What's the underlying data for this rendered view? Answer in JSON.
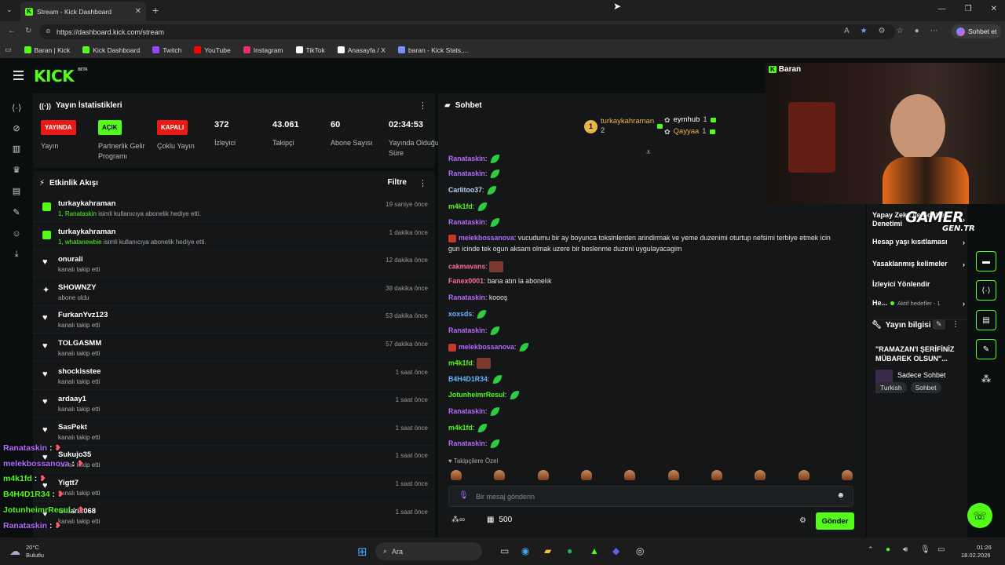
{
  "browser": {
    "tab_title": "Stream - Kick Dashboard",
    "url": "https://dashboard.kick.com/stream",
    "copilot_label": "Sohbet et",
    "bookmarks": [
      {
        "label": "Baran | Kick",
        "color": "#53fc18"
      },
      {
        "label": "Kick Dashboard",
        "color": "#53fc18"
      },
      {
        "label": "Twitch",
        "color": "#9146ff"
      },
      {
        "label": "YouTube",
        "color": "#ff0000"
      },
      {
        "label": "Instagram",
        "color": "#e1306c"
      },
      {
        "label": "TikTok",
        "color": "#ffffff"
      },
      {
        "label": "Anasayfa / X",
        "color": "#ffffff"
      },
      {
        "label": "baran - Kick Stats,...",
        "color": "#7f8cff"
      }
    ]
  },
  "app": {
    "logo": "KICK",
    "logo_sup": "BETA",
    "accent": "#53fc18"
  },
  "stats": {
    "title": "Yayın İstatistikleri",
    "items": [
      {
        "badge": "YAYINDA",
        "label": "Yayın",
        "badge_color": "#e91916"
      },
      {
        "badge": "AÇIK",
        "label": "Partnerlik Gelir Programı",
        "badge_color": "#53fc18"
      },
      {
        "badge": "KAPALI",
        "label": "Çoklu Yayın",
        "badge_color": "#e91916"
      },
      {
        "value": "372",
        "label": "İzleyici"
      },
      {
        "value": "43.061",
        "label": "Takipçi"
      },
      {
        "value": "60",
        "label": "Abone Sayısı"
      },
      {
        "value": "02:34:53",
        "label": "Yayında Olduğu Süre"
      }
    ]
  },
  "activity": {
    "title": "Etkinlik Akışı",
    "filter_label": "Filtre",
    "rows": [
      {
        "name": "turkaykahraman",
        "desc_hl": "1, Ranataskin",
        "desc": " isimli kullanıcıya abonelik hediye etti.",
        "time": "19 saniye önce",
        "icon": "gift"
      },
      {
        "name": "turkaykahraman",
        "desc_hl": "1, whatanewbie",
        "desc": " isimli kullanıcıya abonelik hediye etti.",
        "time": "1 dakika önce",
        "icon": "gift"
      },
      {
        "name": "onurali",
        "desc_hl": "",
        "desc": "kanalı takip etti",
        "time": "12 dakika önce",
        "icon": "heart"
      },
      {
        "name": "SHOWNZY",
        "desc_hl": "",
        "desc": "abone oldu",
        "time": "38 dakika önce",
        "icon": "star"
      },
      {
        "name": "FurkanYvz123",
        "desc_hl": "",
        "desc": "kanalı takip etti",
        "time": "53 dakika önce",
        "icon": "heart"
      },
      {
        "name": "TOLGASMM",
        "desc_hl": "",
        "desc": "kanalı takip etti",
        "time": "57 dakika önce",
        "icon": "heart"
      },
      {
        "name": "shockisstee",
        "desc_hl": "",
        "desc": "kanalı takip etti",
        "time": "1 saat önce",
        "icon": "heart"
      },
      {
        "name": "ardaay1",
        "desc_hl": "",
        "desc": "kanalı takip etti",
        "time": "1 saat önce",
        "icon": "heart"
      },
      {
        "name": "SasPekt",
        "desc_hl": "",
        "desc": "kanalı takip etti",
        "time": "1 saat önce",
        "icon": "heart"
      },
      {
        "name": "Sukujo35",
        "desc_hl": "",
        "desc": "kanalı takip etti",
        "time": "1 saat önce",
        "icon": "heart"
      },
      {
        "name": "Yigtt7",
        "desc_hl": "",
        "desc": "kanalı takip etti",
        "time": "1 saat önce",
        "icon": "heart"
      },
      {
        "name": "Gillaris068",
        "desc_hl": "",
        "desc": "kanalı takip etti",
        "time": "1 saat önce",
        "icon": "heart"
      }
    ]
  },
  "chat": {
    "title": "Sohbet",
    "leaderboard": [
      {
        "rank": "1",
        "name": "turkaykahraman",
        "count": "2"
      },
      {
        "name": "eymhub",
        "count": "1"
      },
      {
        "name": "Qayyaa",
        "count": "1"
      }
    ],
    "messages": [
      {
        "user": "Ranataskin",
        "color": "#b36bff",
        "text": "",
        "emote": "leaf"
      },
      {
        "user": "Ranataskin",
        "color": "#b36bff",
        "text": "",
        "emote": "leaf"
      },
      {
        "user": "Carlitoo37",
        "color": "#b9d1ff",
        "text": "",
        "emote": "leaf"
      },
      {
        "user": "m4k1fd",
        "color": "#53fc18",
        "text": "",
        "emote": "leaf"
      },
      {
        "user": "Ranataskin",
        "color": "#b36bff",
        "text": "",
        "emote": "leaf"
      },
      {
        "user": "melekbossanova",
        "color": "#b36bff",
        "text": "vucudumu bir ay boyunca toksinlerden arindirmak ve yeme duzenimi oturtup nefsimi terbiye etmek icin",
        "cont": "gun icinde tek ogun aksam olmak uzere bir beslenme duzeni uygulayacagim",
        "emote": "",
        "sub": true
      },
      {
        "user": "cakmavans",
        "color": "#ff6b9a",
        "text": "",
        "emote": "img"
      },
      {
        "user": "Fanex0001",
        "color": "#ff6b9a",
        "text": "bana atın la abonelık",
        "emote": ""
      },
      {
        "user": "Ranataskin",
        "color": "#b36bff",
        "text": "koooş",
        "emote": ""
      },
      {
        "user": "xoxsds",
        "color": "#6bb5ff",
        "text": "",
        "emote": "leaf"
      },
      {
        "user": "Ranataskin",
        "color": "#b36bff",
        "text": "",
        "emote": "leaf"
      },
      {
        "user": "melekbossanova",
        "color": "#b36bff",
        "text": "",
        "emote": "leaf",
        "sub": true
      },
      {
        "user": "m4k1fd",
        "color": "#53fc18",
        "text": "",
        "emote": "img"
      },
      {
        "user": "B4H4D1R34",
        "color": "#6bb5ff",
        "text": "",
        "emote": "leaf"
      },
      {
        "user": "JotunheimrResul",
        "color": "#53fc18",
        "text": "",
        "emote": "leaf"
      },
      {
        "user": "Ranataskin",
        "color": "#b36bff",
        "text": "",
        "emote": "leaf"
      },
      {
        "user": "m4k1fd",
        "color": "#53fc18",
        "text": "",
        "emote": "leaf"
      },
      {
        "user": "Ranataskin",
        "color": "#b36bff",
        "text": "",
        "emote": "leaf"
      }
    ],
    "followers_only_label": "Takipçilere Özel",
    "input_placeholder": "Bir mesaj gönderin",
    "points_value": "500",
    "send_label": "Gönder"
  },
  "right": {
    "settings": [
      {
        "label": "Yapay Zeka ile Sohbet Denetimi"
      },
      {
        "label": "Hesap yaşı kısıtlaması"
      },
      {
        "label": "Yasaklanmış kelimeler"
      },
      {
        "label": "İzleyici Yönlendir"
      },
      {
        "label": "He...",
        "note": "Aktif hedefler - 1"
      }
    ],
    "stream_info_title": "Yayın bilgisi",
    "stream_title": "\"RAMAZAN'I ŞERİFİNİZ MÜBAREK OLSUN\"...",
    "category": "Sadece Sohbet",
    "tags": [
      "Turkish",
      "Sohbet"
    ]
  },
  "webcam": {
    "name": "Baran",
    "overlay_text": "GAMER",
    "overlay_sub": "GEN.TR"
  },
  "overlay_chat": [
    {
      "user": "Ranataskin",
      "color": "#b36bff"
    },
    {
      "user": "melekbossanova",
      "color": "#b36bff"
    },
    {
      "user": "m4k1fd",
      "color": "#53fc18"
    },
    {
      "user": "B4H4D1R34",
      "color": "#53fc18"
    },
    {
      "user": "JotunheimrResul",
      "color": "#53fc18"
    },
    {
      "user": "Ranataskin",
      "color": "#b36bff"
    },
    {
      "user": "m4k1fd",
      "color": "#53fc18"
    }
  ],
  "taskbar": {
    "search_label": "Ara",
    "weather_temp": "20°C",
    "weather_desc": "Bulutlu",
    "time": "01:26",
    "date": "18.02.2026"
  }
}
